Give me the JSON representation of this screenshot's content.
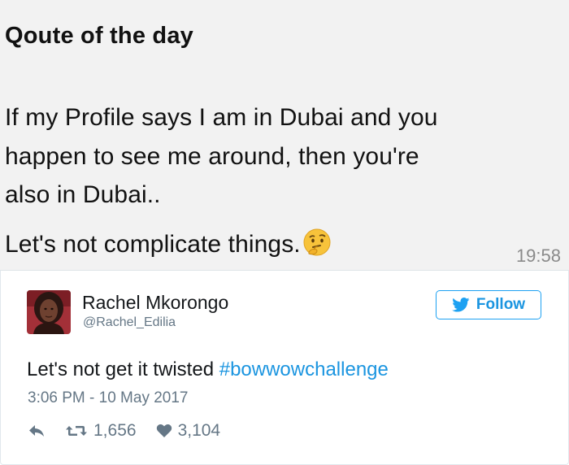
{
  "message": {
    "title": "Qoute of the day",
    "line1": "If my Profile says I am in Dubai and you",
    "line2": "happen to see me around, then you're",
    "line3": "also in Dubai..",
    "line4": "Let's not complicate things.",
    "emoji": "thinking-face-emoji",
    "time": "19:58"
  },
  "tweet": {
    "author_name": "Rachel Mkorongo",
    "author_handle": "@Rachel_Edilia",
    "follow_label": "Follow",
    "text_prefix": "Let's not get it twisted ",
    "hashtag": "#bowwowchallenge",
    "timestamp": "3:06 PM - 10 May 2017",
    "retweets": "1,656",
    "likes": "3,104",
    "icons": {
      "reply": "reply-icon",
      "retweet": "retweet-icon",
      "like": "heart-icon",
      "follow": "twitter-bird-icon"
    },
    "colors": {
      "accent": "#1b95e0",
      "muted": "#657786",
      "text": "#14171a"
    }
  }
}
